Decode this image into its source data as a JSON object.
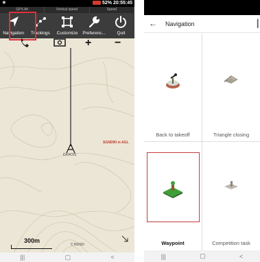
{
  "left_screen": {
    "status_bar": {
      "left_icon": "satellite-icon",
      "right_text": "52% 20:55:45",
      "battery_color": "#d43b2a"
    },
    "instrument_strip": [
      "GPS Alt",
      "Vertical speed",
      "Speed"
    ],
    "menu": [
      {
        "label": "Navigation",
        "icon": "arrow-icon"
      },
      {
        "label": "Tracklogs",
        "icon": "tracklog-icon"
      },
      {
        "label": "Customize",
        "icon": "customize-icon"
      },
      {
        "label": "Preferenc...",
        "icon": "wrench-icon"
      },
      {
        "label": "Quit",
        "icon": "power-icon"
      }
    ],
    "tool_plus": "+",
    "tool_minus": "−",
    "map": {
      "sgnd_label": "SGND90 m AGL",
      "pilot_label": "DXXC01",
      "scale_label": "300m",
      "bottom_place": "C.NOSO"
    },
    "nav_buttons": [
      "|||",
      "▢",
      "<"
    ]
  },
  "right_screen": {
    "title": "Navigation",
    "back_icon": "←",
    "items": [
      {
        "label": "Back to takeoff",
        "icon": "takeoff-icon"
      },
      {
        "label": "Triangle closing",
        "icon": "triangle-icon"
      },
      {
        "label": "Waypoint",
        "icon": "waypoint-icon"
      },
      {
        "label": "Competition task",
        "icon": "competition-icon"
      }
    ],
    "nav_buttons": [
      "|||",
      "▢",
      "<"
    ],
    "highlight_color": "#c43a3a"
  }
}
